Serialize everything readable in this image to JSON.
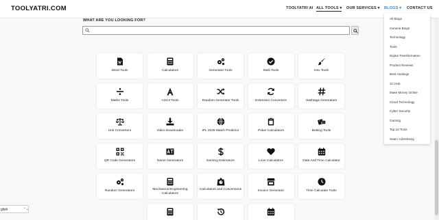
{
  "brand": {
    "logo": "TOOLYATRI.COM"
  },
  "nav": {
    "ai": "TOOLYATRI AI",
    "tools": "ALL TOOLS ▾",
    "services": "OUR SERVICES ▾",
    "blogs": "BLOGS ▾",
    "contact": "CONTACT US"
  },
  "search": {
    "label": "WHAT ARE YOU LOOKING FOR?",
    "value": "",
    "placeholder": ""
  },
  "tools": [
    {
      "label": "Word Tools",
      "icon": "word-file-icon"
    },
    {
      "label": "Calculators",
      "icon": "calculator-icon"
    },
    {
      "label": "Generator Tools",
      "icon": "cogs-icon"
    },
    {
      "label": "Multi Tools",
      "icon": "check-circle-icon"
    },
    {
      "label": "Hex Tools",
      "icon": "paint-brush-icon"
    },
    {
      "label": "Maths Tools",
      "icon": "divide-icon"
    },
    {
      "label": "ASCII Tools",
      "icon": "letter-a-icon"
    },
    {
      "label": "Random Generator Tools",
      "icon": "shuffle-icon"
    },
    {
      "label": "Extension Converters",
      "icon": "sync-icon"
    },
    {
      "label": "Hashtags Generators",
      "icon": "hashtag-icon"
    },
    {
      "label": "Unit Converters",
      "icon": "balance-scale-icon"
    },
    {
      "label": "Video Downloader",
      "icon": "download-icon"
    },
    {
      "label": "IPL 2025 Match Predictor",
      "icon": "globe-icon"
    },
    {
      "label": "Poker Calculators",
      "icon": "clipboard-icon"
    },
    {
      "label": "Betting Tools",
      "icon": "dice-icon"
    },
    {
      "label": "QR Code Generators",
      "icon": "qrcode-icon"
    },
    {
      "label": "Name Generators",
      "icon": "text-icon"
    },
    {
      "label": "Earning Estimators",
      "icon": "dollar-icon"
    },
    {
      "label": "Love Calculators",
      "icon": "heart-icon"
    },
    {
      "label": "Date And Time Calculator",
      "icon": "calendar-icon"
    },
    {
      "label": "Random Generators",
      "icon": "cogs-icon"
    },
    {
      "label": "Mechanical Engineering Calculators",
      "icon": "calculator-icon"
    },
    {
      "label": "Calculators and Conversions",
      "icon": "weight-icon"
    },
    {
      "label": "Invoice Generator",
      "icon": "store-icon"
    },
    {
      "label": "Time Calculate Tools",
      "icon": "clock-icon"
    },
    {
      "label": "",
      "icon": "calculator-icon"
    },
    {
      "label": "",
      "icon": "history-icon"
    },
    {
      "label": "",
      "icon": "calendar-icon"
    }
  ],
  "blogs_menu": [
    "All Blogs",
    "General Blogs",
    "Technology",
    "Tools",
    "Digital Transformation",
    "Product Reviews",
    "Best Hostings",
    "1C Hub",
    "Make Money Online",
    "Cloud Technology",
    "Cyber Security",
    "Gaming",
    "Top 10 Tools",
    "Seam Advertising"
  ],
  "language": {
    "value": "glish"
  },
  "colors": {
    "accent": "#2a8ad6",
    "background": "#f7f8f9",
    "card": "#ffffff"
  }
}
